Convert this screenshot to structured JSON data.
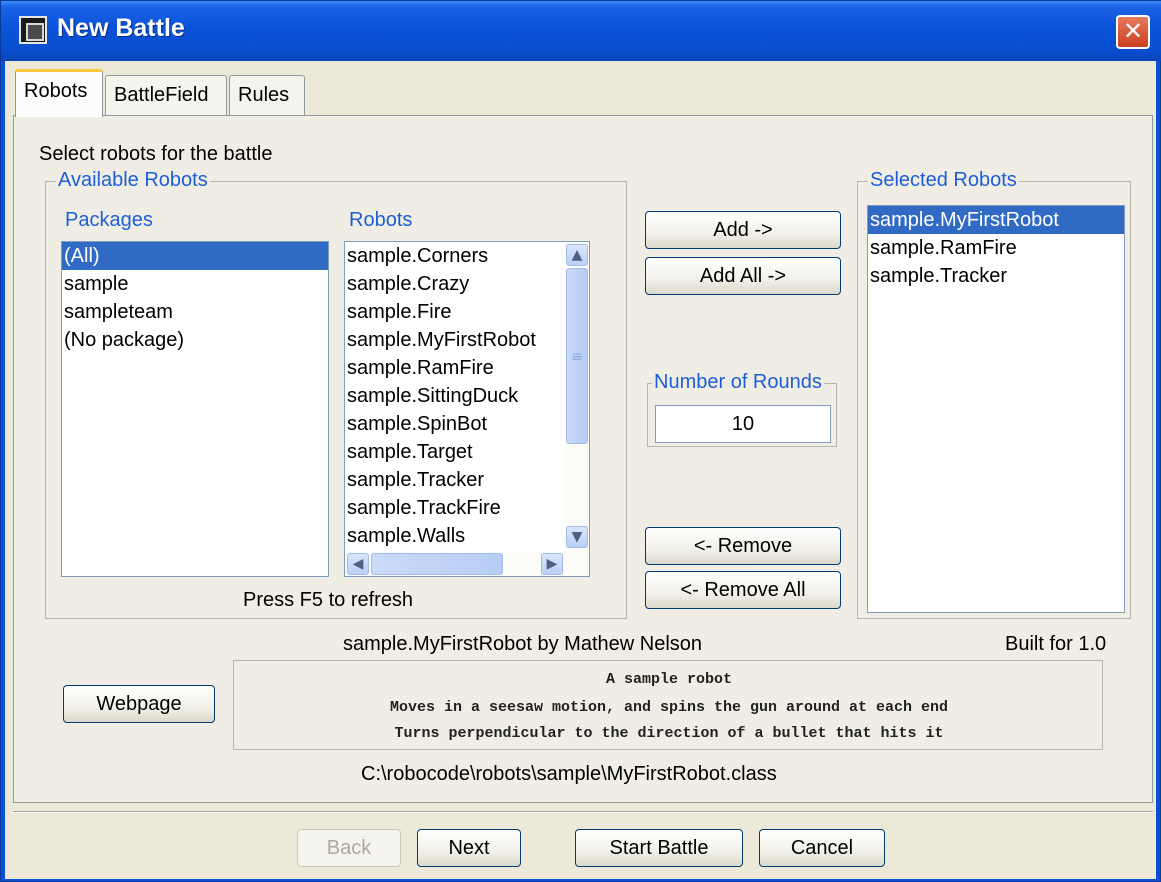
{
  "window": {
    "title": "New Battle",
    "close_glyph": "✕"
  },
  "tabs": [
    {
      "label": "Robots",
      "active": true
    },
    {
      "label": "BattleField",
      "active": false
    },
    {
      "label": "Rules",
      "active": false
    }
  ],
  "robots_tab": {
    "instruction": "Select robots for the battle",
    "available_title": "Available Robots",
    "packages_header": "Packages",
    "robots_header": "Robots",
    "packages": [
      "(All)",
      "sample",
      "sampleteam",
      "(No package)"
    ],
    "selected_package": "(All)",
    "robots": [
      "sample.Corners",
      "sample.Crazy",
      "sample.Fire",
      "sample.MyFirstRobot",
      "sample.RamFire",
      "sample.SittingDuck",
      "sample.SpinBot",
      "sample.Target",
      "sample.Tracker",
      "sample.TrackFire",
      "sample.Walls"
    ],
    "refresh_hint": "Press F5 to refresh",
    "add_label": "Add ->",
    "add_all_label": "Add All ->",
    "rounds_title": "Number of Rounds",
    "rounds_value": "10",
    "remove_label": "<- Remove",
    "remove_all_label": "<- Remove All",
    "selected_title": "Selected Robots",
    "selected_robots": [
      "sample.MyFirstRobot",
      "sample.RamFire",
      "sample.Tracker"
    ],
    "selected_highlight": "sample.MyFirstRobot",
    "robot_info": "sample.MyFirstRobot by Mathew Nelson",
    "built_for": "Built for 1.0",
    "webpage_label": "Webpage",
    "description": [
      "A sample robot",
      "Moves in a seesaw motion, and spins the gun around at each end",
      "Turns perpendicular to the direction of a bullet that hits it"
    ],
    "file_path": "C:\\robocode\\robots\\sample\\MyFirstRobot.class"
  },
  "footer": {
    "back_label": "Back",
    "next_label": "Next",
    "start_label": "Start Battle",
    "cancel_label": "Cancel"
  },
  "scroll_glyphs": {
    "up": "▲",
    "down": "▼",
    "left": "◀",
    "right": "▶",
    "grip": "≡"
  }
}
